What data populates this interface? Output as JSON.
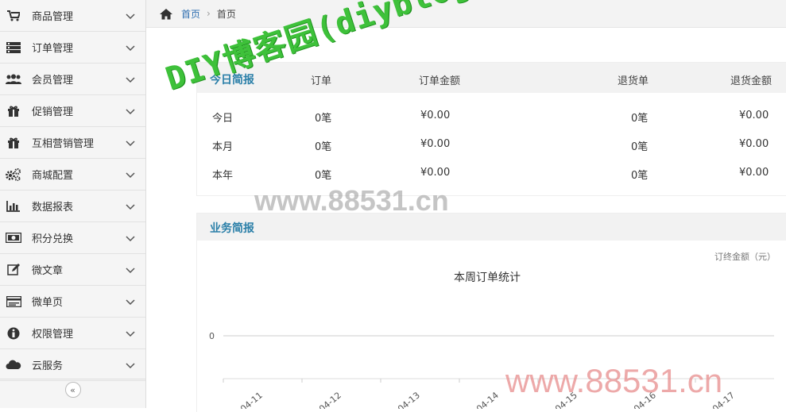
{
  "sidebar": {
    "items": [
      {
        "label": "商品管理",
        "icon": "cart-icon"
      },
      {
        "label": "订单管理",
        "icon": "list-icon"
      },
      {
        "label": "会员管理",
        "icon": "users-icon"
      },
      {
        "label": "促销管理",
        "icon": "gift-icon"
      },
      {
        "label": "互相营销管理",
        "icon": "gift-icon"
      },
      {
        "label": "商城配置",
        "icon": "gears-icon"
      },
      {
        "label": "数据报表",
        "icon": "bar-chart-icon"
      },
      {
        "label": "积分兑换",
        "icon": "money-icon"
      },
      {
        "label": "微文章",
        "icon": "edit-icon"
      },
      {
        "label": "微单页",
        "icon": "card-icon"
      },
      {
        "label": "权限管理",
        "icon": "info-icon"
      },
      {
        "label": "云服务",
        "icon": "cloud-icon"
      }
    ],
    "collapse_label": "«"
  },
  "breadcrumb": {
    "home": "首页",
    "current": "首页",
    "separator": "›"
  },
  "today_report": {
    "title": "今日简报",
    "columns": [
      "订单",
      "订单金额",
      "退货单",
      "退货金额"
    ],
    "rows": [
      {
        "label": "今日",
        "orders": "0笔",
        "amount": "¥0.00",
        "returns": "0笔",
        "return_amount": "¥0.00"
      },
      {
        "label": "本月",
        "orders": "0笔",
        "amount": "¥0.00",
        "returns": "0笔",
        "return_amount": "¥0.00"
      },
      {
        "label": "本年",
        "orders": "0笔",
        "amount": "¥0.00",
        "returns": "0笔",
        "return_amount": "¥0.00"
      }
    ]
  },
  "business_report": {
    "title": "业务简报",
    "legend": "订终金额（元）"
  },
  "chart_data": {
    "type": "line",
    "title": "本周订单统计",
    "categories": [
      "-04-11",
      "-04-12",
      "-04-13",
      "-04-14",
      "-04-15",
      "-04-16",
      "-04-17"
    ],
    "series": [
      {
        "name": "订终金额（元）",
        "values": [
          0,
          0,
          0,
          0,
          0,
          0,
          0
        ]
      }
    ],
    "ylim": [
      0,
      1
    ],
    "y_ticks": [
      "0"
    ],
    "grid": true
  },
  "watermarks": {
    "main": "DIY博客园(diybloghome.com)",
    "center": "www.88531.cn",
    "corner": "www.88531.cn"
  },
  "colors": {
    "accent": "#2a7fa8",
    "link": "#2f6fb0",
    "watermark_green": "#3ec13a"
  }
}
